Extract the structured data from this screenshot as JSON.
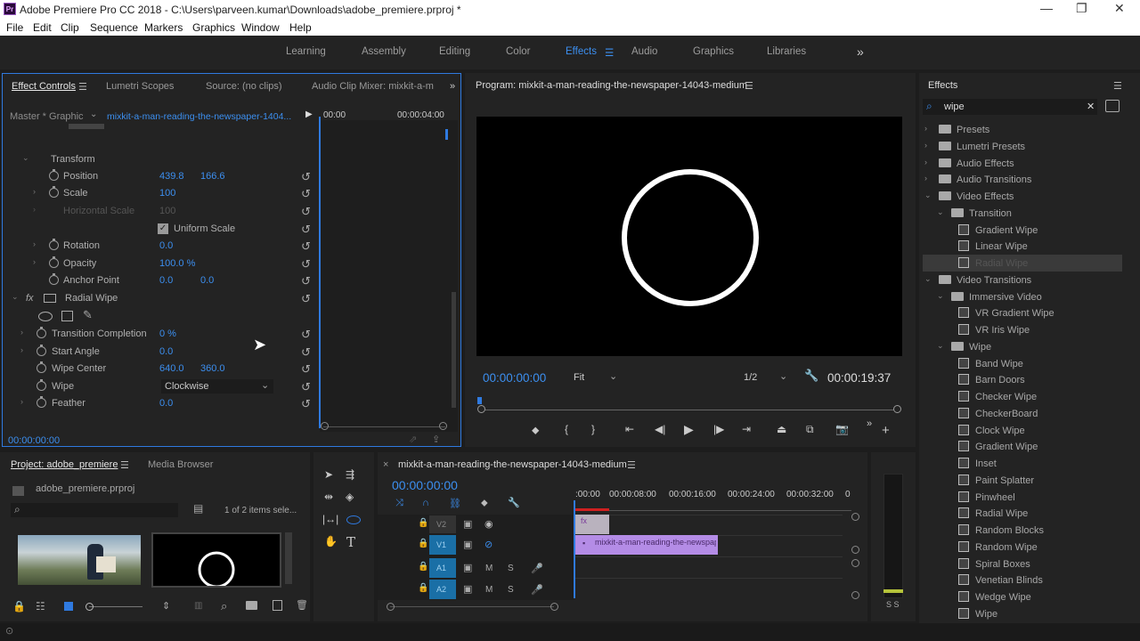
{
  "window": {
    "app_icon": "Pr",
    "title": "Adobe Premiere Pro CC 2018 - C:\\Users\\parveen.kumar\\Downloads\\adobe_premiere.prproj *",
    "minimize": "—",
    "maximize": "❐",
    "close": "✕"
  },
  "menu": [
    "File",
    "Edit",
    "Clip",
    "Sequence",
    "Markers",
    "Graphics",
    "Window",
    "Help"
  ],
  "workspaces": {
    "items": [
      "Learning",
      "Assembly",
      "Editing",
      "Color",
      "Effects",
      "Audio",
      "Graphics",
      "Libraries"
    ],
    "active": "Effects",
    "more": "»",
    "menu_glyph": "☰"
  },
  "effect_controls": {
    "tabs": [
      "Effect Controls",
      "Lumetri Scopes",
      "Source: (no clips)",
      "Audio Clip Mixer: mixkit-a-m"
    ],
    "more": "»",
    "source": "Master * Graphic",
    "clip": "mixkit-a-man-reading-the-newspaper-1404...",
    "time_start": "00:00",
    "time_end": "00:00:04:00",
    "section_transform": "Transform",
    "position": {
      "label": "Position",
      "x": "439.8",
      "y": "166.6"
    },
    "scale": {
      "label": "Scale",
      "value": "100"
    },
    "hscale": {
      "label": "Horizontal Scale",
      "value": "100"
    },
    "uniform": "Uniform Scale",
    "rotation": {
      "label": "Rotation",
      "value": "0.0"
    },
    "opacity": {
      "label": "Opacity",
      "value": "100.0 %"
    },
    "anchor": {
      "label": "Anchor Point",
      "x": "0.0",
      "y": "0.0"
    },
    "fx_label": "fx",
    "radial": "Radial Wipe",
    "completion": {
      "label": "Transition Completion",
      "value": "0 %"
    },
    "start_angle": {
      "label": "Start Angle",
      "value": "0.0"
    },
    "wipe_center": {
      "label": "Wipe Center",
      "x": "640.0",
      "y": "360.0"
    },
    "wipe": {
      "label": "Wipe",
      "value": "Clockwise"
    },
    "feather": {
      "label": "Feather",
      "value": "0.0"
    },
    "timecode": "00:00:00:00"
  },
  "program": {
    "title": "Program: mixkit-a-man-reading-the-newspaper-14043-medium",
    "timecode": "00:00:00:00",
    "fit": "Fit",
    "res": "1/2",
    "duration": "00:00:19:37"
  },
  "effects_panel": {
    "title": "Effects",
    "search": "wipe",
    "tree": [
      {
        "label": "Presets",
        "type": "bin",
        "level": 0,
        "arrow": "›"
      },
      {
        "label": "Lumetri Presets",
        "type": "bin",
        "level": 0,
        "arrow": "›"
      },
      {
        "label": "Audio Effects",
        "type": "folder",
        "level": 0,
        "arrow": "›"
      },
      {
        "label": "Audio Transitions",
        "type": "folder",
        "level": 0,
        "arrow": "›"
      },
      {
        "label": "Video Effects",
        "type": "folder",
        "level": 0,
        "arrow": "⌄"
      },
      {
        "label": "Transition",
        "type": "folder",
        "level": 1,
        "arrow": "⌄"
      },
      {
        "label": "Gradient Wipe",
        "type": "fx",
        "level": 2
      },
      {
        "label": "Linear Wipe",
        "type": "fx",
        "level": 2
      },
      {
        "label": "Radial Wipe",
        "type": "fx",
        "level": 2,
        "selected": true
      },
      {
        "label": "Video Transitions",
        "type": "folder",
        "level": 0,
        "arrow": "⌄"
      },
      {
        "label": "Immersive Video",
        "type": "folder",
        "level": 1,
        "arrow": "⌄"
      },
      {
        "label": "VR Gradient Wipe",
        "type": "tr",
        "level": 2
      },
      {
        "label": "VR Iris Wipe",
        "type": "tr",
        "level": 2
      },
      {
        "label": "Wipe",
        "type": "folder",
        "level": 1,
        "arrow": "⌄"
      },
      {
        "label": "Band Wipe",
        "type": "tr",
        "level": 2
      },
      {
        "label": "Barn Doors",
        "type": "tr",
        "level": 2
      },
      {
        "label": "Checker Wipe",
        "type": "tr",
        "level": 2
      },
      {
        "label": "CheckerBoard",
        "type": "tr",
        "level": 2
      },
      {
        "label": "Clock Wipe",
        "type": "tr",
        "level": 2
      },
      {
        "label": "Gradient Wipe",
        "type": "tr",
        "level": 2
      },
      {
        "label": "Inset",
        "type": "tr",
        "level": 2
      },
      {
        "label": "Paint Splatter",
        "type": "tr",
        "level": 2
      },
      {
        "label": "Pinwheel",
        "type": "tr",
        "level": 2
      },
      {
        "label": "Radial Wipe",
        "type": "tr",
        "level": 2
      },
      {
        "label": "Random Blocks",
        "type": "tr",
        "level": 2
      },
      {
        "label": "Random Wipe",
        "type": "tr",
        "level": 2
      },
      {
        "label": "Spiral Boxes",
        "type": "tr",
        "level": 2
      },
      {
        "label": "Venetian Blinds",
        "type": "tr",
        "level": 2
      },
      {
        "label": "Wedge Wipe",
        "type": "tr",
        "level": 2
      },
      {
        "label": "Wipe",
        "type": "tr",
        "level": 2
      }
    ]
  },
  "project": {
    "tabs": [
      "Project: adobe_premiere",
      "Media Browser"
    ],
    "file": "adobe_premiere.prproj",
    "count": "1 of 2 items sele..."
  },
  "timeline": {
    "title": "mixkit-a-man-reading-the-newspaper-14043-medium",
    "timecode": "00:00:00:00",
    "ruler": [
      ":00:00",
      "00:00:08:00",
      "00:00:16:00",
      "00:00:24:00",
      "00:00:32:00",
      "0"
    ],
    "tracks": [
      "V2",
      "V1",
      "A1",
      "A2"
    ],
    "clip": "mixkit-a-man-reading-the-newspaper",
    "meter": "S S"
  },
  "colors": {
    "accent": "#3c8ff0",
    "clip": "#b48ce6",
    "panel": "#232323",
    "focus": "#2f7ae0"
  }
}
